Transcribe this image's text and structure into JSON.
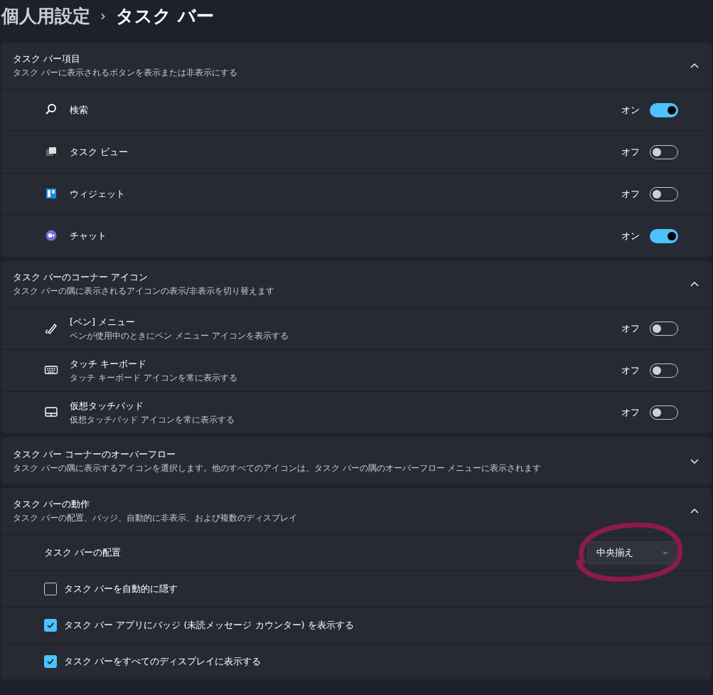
{
  "breadcrumb": {
    "parent": "個人用設定",
    "separator": "›",
    "current": "タスク バー"
  },
  "sections": [
    {
      "title": "タスク バー項目",
      "description": "タスク バーに表示されるボタンを表示または非表示にする",
      "expanded": true,
      "items": [
        {
          "kind": "toggle",
          "label": "検索",
          "on": true,
          "state_label": "オン"
        },
        {
          "kind": "toggle",
          "label": "タスク ビュー",
          "on": false,
          "state_label": "オフ"
        },
        {
          "kind": "toggle",
          "label": "ウィジェット",
          "on": false,
          "state_label": "オフ"
        },
        {
          "kind": "toggle",
          "label": "チャット",
          "on": true,
          "state_label": "オン"
        }
      ]
    },
    {
      "title": "タスク バーのコーナー アイコン",
      "description": "タスク バーの隅に表示されるアイコンの表示/非表示を切り替えます",
      "expanded": true,
      "items": [
        {
          "kind": "toggle",
          "label": "[ペン] メニュー",
          "description": "ペンが使用中のときにペン メニュー アイコンを表示する",
          "on": false,
          "state_label": "オフ"
        },
        {
          "kind": "toggle",
          "label": "タッチ キーボード",
          "description": "タッチ キーボード アイコンを常に表示する",
          "on": false,
          "state_label": "オフ"
        },
        {
          "kind": "toggle",
          "label": "仮想タッチパッド",
          "description": "仮想タッチパッド アイコンを常に表示する",
          "on": false,
          "state_label": "オフ"
        }
      ]
    },
    {
      "title": "タスク バー コーナーのオーバーフロー",
      "description": "タスク バーの隅に表示するアイコンを選択します。他のすべてのアイコンは、タスク バーの隅のオーバーフロー メニューに表示されます",
      "expanded": false
    },
    {
      "title": "タスク バーの動作",
      "description": "タスク バーの配置、バッジ、自動的に非表示、および複数のディスプレイ",
      "expanded": true,
      "items": [
        {
          "kind": "dropdown",
          "label": "タスク バーの配置",
          "value": "中央揃え",
          "annotated": true
        },
        {
          "kind": "checkbox",
          "label": "タスク バーを自動的に隠す",
          "checked": false
        },
        {
          "kind": "checkbox",
          "label": "タスク バー アプリにバッジ (未読メッセージ カウンター) を表示する",
          "checked": true
        },
        {
          "kind": "checkbox",
          "label": "タスク バーをすべてのディスプレイに表示する",
          "checked": true
        }
      ]
    }
  ]
}
